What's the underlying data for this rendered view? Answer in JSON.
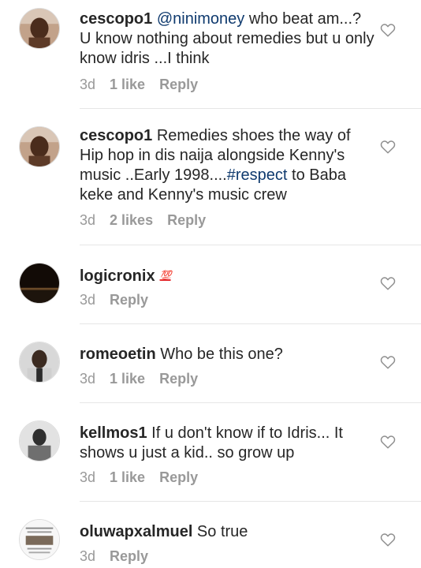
{
  "comments": [
    {
      "username": "cescopo1",
      "mention": "@ninimoney",
      "text": " who beat am...? U know nothing about remedies but u only know idris ...I think",
      "time": "3d",
      "likes": "1 like",
      "reply": "Reply"
    },
    {
      "username": "cescopo1",
      "text_before": " Remedies shoes the way of Hip hop in dis naija alongside Kenny's music ..Early 1998....",
      "hashtag": "#respect",
      "text_after": " to Baba keke and Kenny's music crew",
      "time": "3d",
      "likes": "2 likes",
      "reply": "Reply"
    },
    {
      "username": "logicronix",
      "emoji": "💯",
      "time": "3d",
      "reply": "Reply"
    },
    {
      "username": "romeoetin",
      "text": " Who be this one?",
      "time": "3d",
      "likes": "1 like",
      "reply": "Reply"
    },
    {
      "username": "kellmos1",
      "text": " If u don't know if to Idris... It shows u just a kid.. so grow up",
      "time": "3d",
      "likes": "1 like",
      "reply": "Reply"
    },
    {
      "username": "oluwapxalmuel",
      "text": " So true",
      "time": "3d",
      "reply": "Reply"
    }
  ],
  "colors": {
    "text": "#262626",
    "meta": "#999999",
    "link": "#0f3a6e",
    "divider": "#e6e6e6"
  },
  "icons": {
    "like": "heart-outline-icon"
  }
}
